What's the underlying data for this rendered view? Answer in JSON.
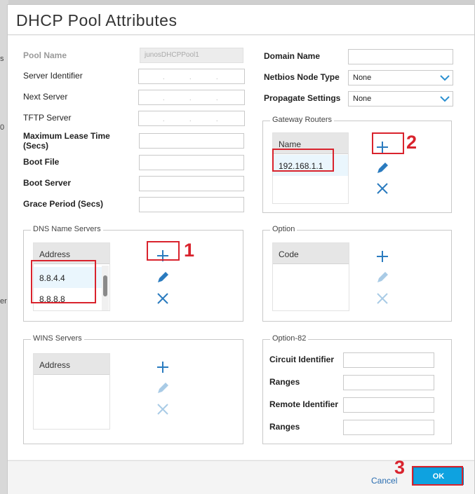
{
  "dialog": {
    "title": "DHCP Pool Attributes"
  },
  "background": {
    "fragments": [
      "s",
      "0",
      "er"
    ]
  },
  "left": {
    "pool_name": {
      "label": "Pool Name",
      "value": "junosDHCPPool1"
    },
    "server_identifier": {
      "label": "Server Identifier"
    },
    "next_server": {
      "label": "Next Server"
    },
    "tftp_server": {
      "label": "TFTP Server"
    },
    "max_lease_time": {
      "label_line1": "Maximum Lease Time",
      "label_line2": "(Secs)"
    },
    "boot_file": {
      "label": "Boot File"
    },
    "boot_server": {
      "label": "Boot Server"
    },
    "grace_period": {
      "label": "Grace Period (Secs)"
    },
    "ip_dots": "."
  },
  "right": {
    "domain_name": {
      "label": "Domain Name"
    },
    "netbios_node_type": {
      "label": "Netbios Node Type",
      "value": "None"
    },
    "propagate_settings": {
      "label": "Propagate Settings",
      "value": "None"
    }
  },
  "gateway_routers": {
    "legend": "Gateway Routers",
    "column": "Name",
    "rows": [
      "192.168.1.1"
    ]
  },
  "dns_name_servers": {
    "legend": "DNS Name Servers",
    "column": "Address",
    "rows": [
      "8.8.4.4",
      "8.8.8.8"
    ]
  },
  "option": {
    "legend": "Option",
    "column": "Code"
  },
  "wins_servers": {
    "legend": "WINS Servers",
    "column": "Address"
  },
  "option82": {
    "legend": "Option-82",
    "circuit_identifier": "Circuit Identifier",
    "ranges1": "Ranges",
    "remote_identifier": "Remote Identifier",
    "ranges2": "Ranges"
  },
  "footer": {
    "cancel": "Cancel",
    "ok": "OK"
  },
  "annotations": {
    "n1": "1",
    "n2": "2",
    "n3": "3"
  },
  "colors": {
    "accent": "#0ea2e0",
    "icon_blue": "#2a7bbf",
    "annotation_red": "#d9232d"
  }
}
